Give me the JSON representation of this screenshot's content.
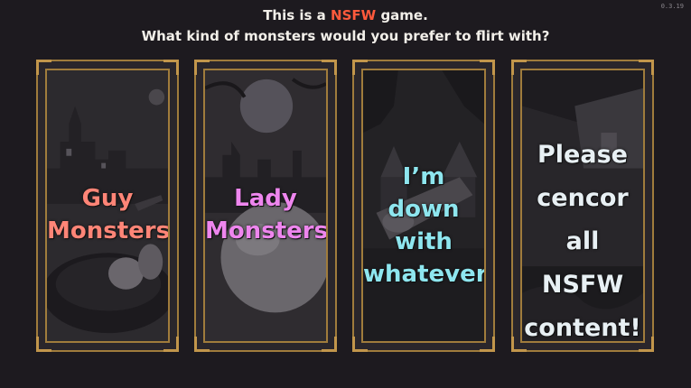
{
  "version": "0.3.19",
  "header": {
    "line1_prefix": "This is a",
    "line1_highlight": "NSFW",
    "line1_suffix": "game.",
    "line2": "What kind of monsters would you prefer to flirt with?"
  },
  "options": [
    {
      "lines": [
        "Guy",
        "Monsters!"
      ],
      "color": "#ff8577"
    },
    {
      "lines": [
        "Lady",
        "Monsters!"
      ],
      "color": "#ee86ee"
    },
    {
      "lines": [
        "I’m down",
        "with",
        "whatever"
      ],
      "color": "#8ee6ef"
    },
    {
      "lines": [
        "Please",
        "cencor",
        "all NSFW",
        "content!"
      ],
      "color": "#e8f0f4"
    }
  ],
  "colors": {
    "frame": "#a07c3c",
    "highlight": "#ff5a3c",
    "background": "#1d1a1f"
  }
}
